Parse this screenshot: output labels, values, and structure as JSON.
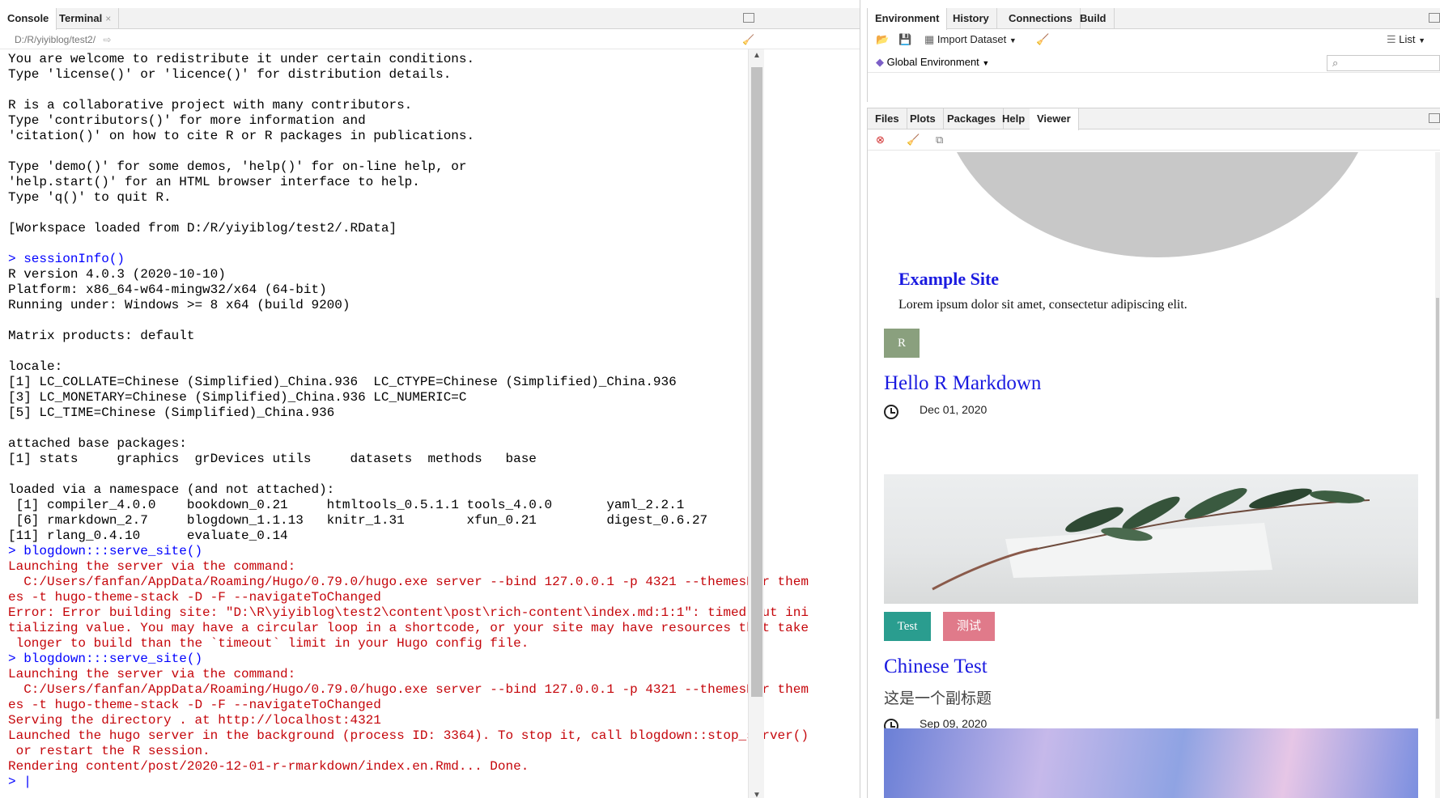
{
  "console": {
    "tabs": [
      {
        "label": "Console"
      },
      {
        "label": "Terminal",
        "close": "×"
      }
    ],
    "path": "D:/R/yiyiblog/test2/",
    "lines": [
      {
        "text": "You are welcome to redistribute it under certain conditions.",
        "color": "black"
      },
      {
        "text": "Type 'license()' or 'licence()' for distribution details.",
        "color": "black"
      },
      {
        "text": "",
        "color": "black"
      },
      {
        "text": "R is a collaborative project with many contributors.",
        "color": "black"
      },
      {
        "text": "Type 'contributors()' for more information and",
        "color": "black"
      },
      {
        "text": "'citation()' on how to cite R or R packages in publications.",
        "color": "black"
      },
      {
        "text": "",
        "color": "black"
      },
      {
        "text": "Type 'demo()' for some demos, 'help()' for on-line help, or",
        "color": "black"
      },
      {
        "text": "'help.start()' for an HTML browser interface to help.",
        "color": "black"
      },
      {
        "text": "Type 'q()' to quit R.",
        "color": "black"
      },
      {
        "text": "",
        "color": "black"
      },
      {
        "text": "[Workspace loaded from D:/R/yiyiblog/test2/.RData]",
        "color": "black"
      },
      {
        "text": "",
        "color": "black"
      },
      {
        "text": "> sessionInfo()",
        "color": "blue"
      },
      {
        "text": "R version 4.0.3 (2020-10-10)",
        "color": "black"
      },
      {
        "text": "Platform: x86_64-w64-mingw32/x64 (64-bit)",
        "color": "black"
      },
      {
        "text": "Running under: Windows >= 8 x64 (build 9200)",
        "color": "black"
      },
      {
        "text": "",
        "color": "black"
      },
      {
        "text": "Matrix products: default",
        "color": "black"
      },
      {
        "text": "",
        "color": "black"
      },
      {
        "text": "locale:",
        "color": "black"
      },
      {
        "text": "[1] LC_COLLATE=Chinese (Simplified)_China.936  LC_CTYPE=Chinese (Simplified)_China.936",
        "color": "black"
      },
      {
        "text": "[3] LC_MONETARY=Chinese (Simplified)_China.936 LC_NUMERIC=C",
        "color": "black"
      },
      {
        "text": "[5] LC_TIME=Chinese (Simplified)_China.936",
        "color": "black"
      },
      {
        "text": "",
        "color": "black"
      },
      {
        "text": "attached base packages:",
        "color": "black"
      },
      {
        "text": "[1] stats     graphics  grDevices utils     datasets  methods   base",
        "color": "black"
      },
      {
        "text": "",
        "color": "black"
      },
      {
        "text": "loaded via a namespace (and not attached):",
        "color": "black"
      },
      {
        "text": " [1] compiler_4.0.0    bookdown_0.21     htmltools_0.5.1.1 tools_4.0.0       yaml_2.2.1",
        "color": "black"
      },
      {
        "text": " [6] rmarkdown_2.7     blogdown_1.1.13   knitr_1.31        xfun_0.21         digest_0.6.27",
        "color": "black"
      },
      {
        "text": "[11] rlang_0.4.10      evaluate_0.14",
        "color": "black"
      },
      {
        "text": "> blogdown:::serve_site()",
        "color": "blue"
      },
      {
        "text": "Launching the server via the command:",
        "color": "red"
      },
      {
        "text": "  C:/Users/fanfan/AppData/Roaming/Hugo/0.79.0/hugo.exe server --bind 127.0.0.1 -p 4321 --themesDir them",
        "color": "red"
      },
      {
        "text": "es -t hugo-theme-stack -D -F --navigateToChanged",
        "color": "red"
      },
      {
        "text": "Error: Error building site: \"D:\\R\\yiyiblog\\test2\\content\\post\\rich-content\\index.md:1:1\": timed out ini",
        "color": "red"
      },
      {
        "text": "tializing value. You may have a circular loop in a shortcode, or your site may have resources that take",
        "color": "red"
      },
      {
        "text": " longer to build than the `timeout` limit in your Hugo config file.",
        "color": "red"
      },
      {
        "text": "> blogdown:::serve_site()",
        "color": "blue"
      },
      {
        "text": "Launching the server via the command:",
        "color": "red"
      },
      {
        "text": "  C:/Users/fanfan/AppData/Roaming/Hugo/0.79.0/hugo.exe server --bind 127.0.0.1 -p 4321 --themesDir them",
        "color": "red"
      },
      {
        "text": "es -t hugo-theme-stack -D -F --navigateToChanged",
        "color": "red"
      },
      {
        "text": "Serving the directory . at http://localhost:4321",
        "color": "red"
      },
      {
        "text": "Launched the hugo server in the background (process ID: 3364). To stop it, call blogdown::stop_server()",
        "color": "red"
      },
      {
        "text": " or restart the R session.",
        "color": "red"
      },
      {
        "text": "Rendering content/post/2020-12-01-r-rmarkdown/index.en.Rmd... Done.",
        "color": "red"
      },
      {
        "text": "> |",
        "color": "blue"
      }
    ]
  },
  "environment": {
    "tabs": [
      {
        "label": "Environment"
      },
      {
        "label": "History"
      },
      {
        "label": "Connections"
      },
      {
        "label": "Build"
      }
    ],
    "import_dataset": "Import Dataset",
    "view_mode": "List",
    "scope": "Global Environment",
    "search_placeholder": ""
  },
  "viewer_pane": {
    "tabs": [
      {
        "label": "Files"
      },
      {
        "label": "Plots"
      },
      {
        "label": "Packages"
      },
      {
        "label": "Help"
      },
      {
        "label": "Viewer"
      }
    ],
    "site_title": "Example Site",
    "site_description": "Lorem ipsum dolor sit amet, consectetur adipiscing elit.",
    "posts": [
      {
        "tag": "R",
        "title": "Hello R Markdown",
        "date": "Dec 01, 2020"
      },
      {
        "tags": [
          "Test",
          "测试"
        ],
        "title": "Chinese Test",
        "subtitle": "这是一个副标题",
        "date": "Sep 09, 2020"
      }
    ]
  },
  "colors": {
    "console_text": "#000000",
    "console_command": "#0000ff",
    "console_message": "#c5060b",
    "site_link": "#1a1ae0",
    "tag_r": "#8aa07e",
    "tag_test": "#2a9d8f",
    "tag_ceshi": "#e07a8a"
  }
}
